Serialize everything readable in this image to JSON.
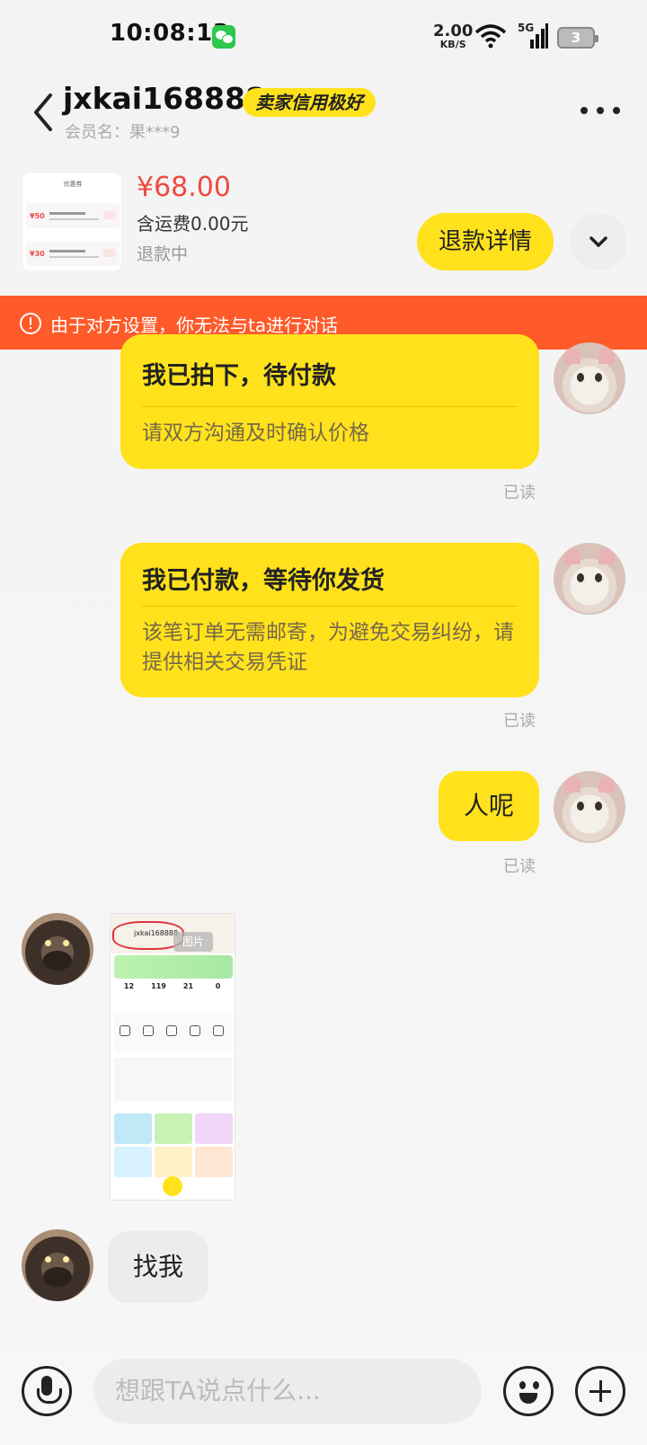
{
  "status_bar": {
    "time": "10:08:13",
    "net_speed_value": "2.00",
    "net_speed_unit": "KB/S",
    "signal_label": "5G",
    "battery": "3"
  },
  "header": {
    "back_icon": "chevron-left-icon",
    "username": "jxkai168888",
    "credit_badge": "卖家信用极好",
    "member_name": "会员名：果***9",
    "more_icon": "more-dots-icon"
  },
  "order": {
    "thumb_title": "优惠券",
    "thumb_amounts": [
      "¥50",
      "¥30"
    ],
    "price": "¥68.00",
    "shipping": "含运费0.00元",
    "status": "退款中",
    "refund_button": "退款详情",
    "expand_icon": "chevron-down-icon"
  },
  "warning": {
    "icon": "warning-circle-icon",
    "text": "由于对方设置，你无法与ta进行对话"
  },
  "messages": {
    "card1": {
      "title": "我已拍下，待付款",
      "body": "请双方沟通及时确认价格",
      "read": "已读"
    },
    "card2": {
      "title": "我已付款，等待你发货",
      "body": "该笔订单无需邮寄，为避免交易纠纷，请提供相关交易凭证",
      "read": "已读"
    },
    "text1": {
      "text": "人呢",
      "read": "已读"
    },
    "image1": {
      "tag": "图片",
      "username": "jxkai168888",
      "stats": [
        "12",
        "119",
        "21",
        "0"
      ]
    },
    "text2": {
      "text": "找我"
    }
  },
  "input_bar": {
    "placeholder": "想跟TA说点什么...",
    "voice_icon": "microphone-icon",
    "emoji_icon": "emoji-icon",
    "plus_icon": "plus-icon"
  },
  "colors": {
    "accent_yellow": "#ffe21c",
    "warning_orange": "#ff5a2a",
    "price_red": "#ee4a3f"
  }
}
